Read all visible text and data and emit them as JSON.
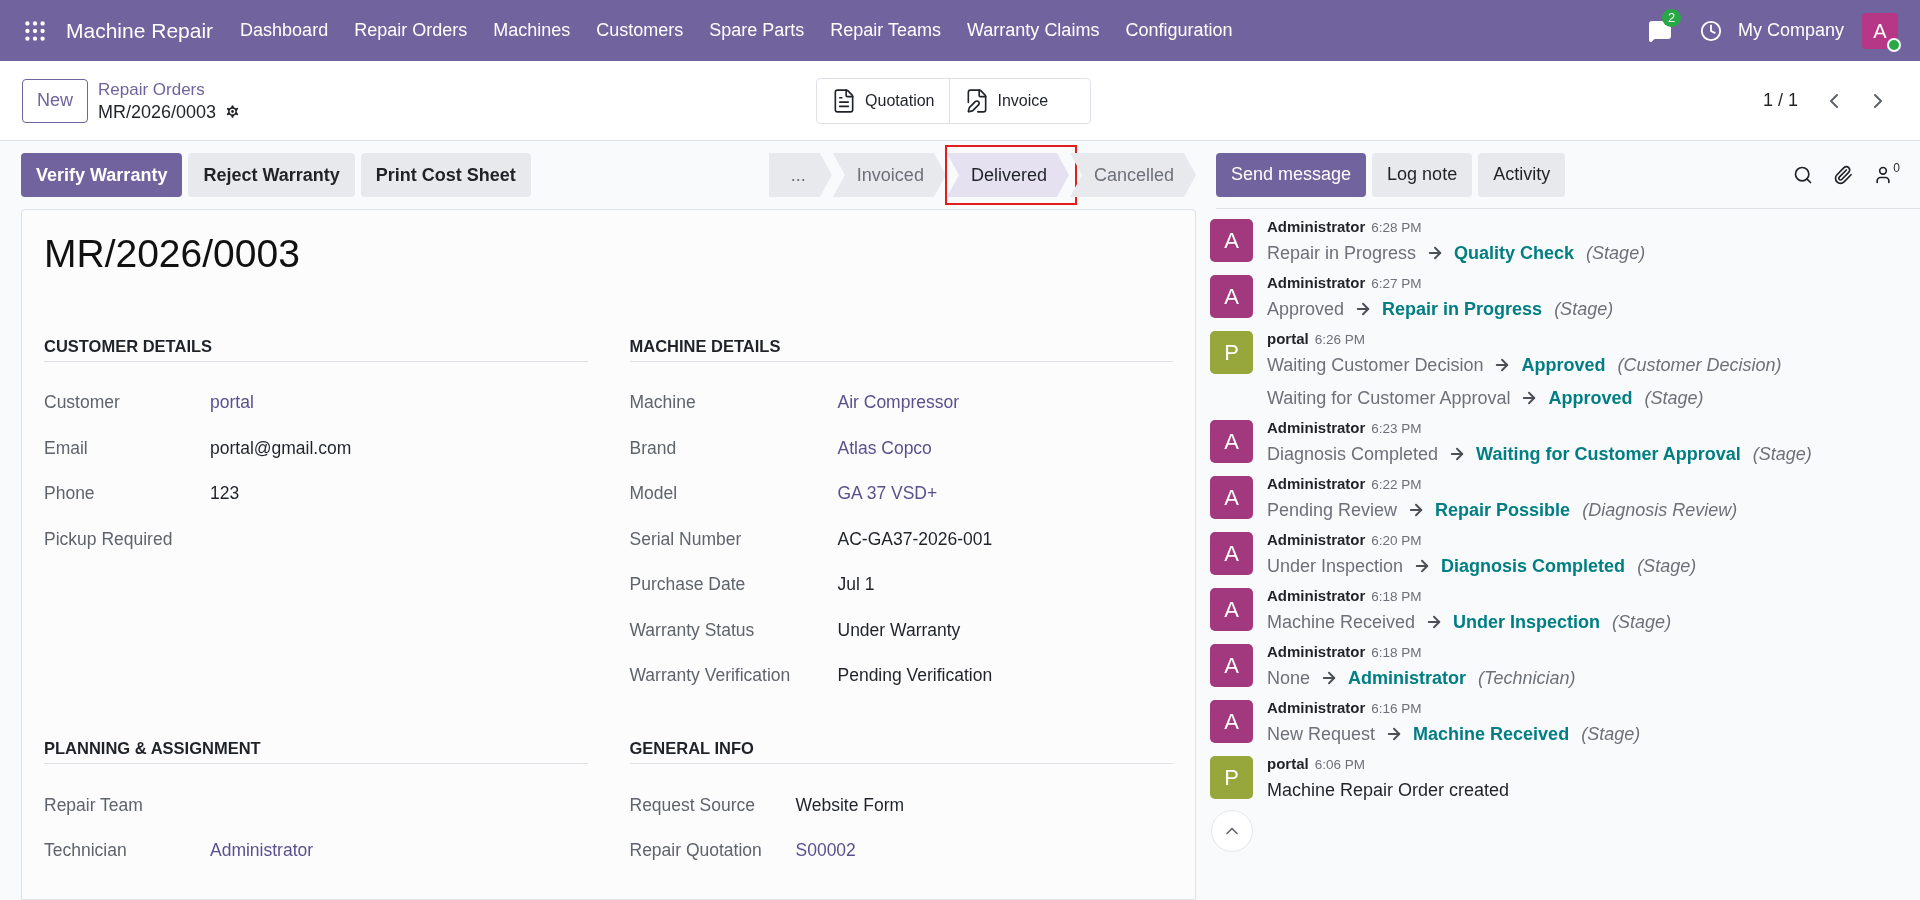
{
  "navbar": {
    "app_name": "Machine Repair",
    "menu": [
      "Dashboard",
      "Repair Orders",
      "Machines",
      "Customers",
      "Spare Parts",
      "Repair Teams",
      "Warranty Claims",
      "Configuration"
    ],
    "messages_badge": "2",
    "company": "My Company",
    "avatar_letter": "A"
  },
  "control_panel": {
    "new_button": "New",
    "breadcrumb": "Repair Orders",
    "record": "MR/2026/0003",
    "smart_buttons": [
      {
        "kind": "quotation",
        "label": "Quotation"
      },
      {
        "kind": "invoice",
        "label": "Invoice"
      }
    ],
    "pager": "1 / 1"
  },
  "actions": [
    {
      "label": "Verify Warranty",
      "primary": true
    },
    {
      "label": "Reject Warranty",
      "primary": false
    },
    {
      "label": "Print Cost Sheet",
      "primary": false
    }
  ],
  "stages": [
    {
      "label": "...",
      "selected": false,
      "highlighted": false
    },
    {
      "label": "Invoiced",
      "selected": false,
      "highlighted": false
    },
    {
      "label": "Delivered",
      "selected": true,
      "highlighted": true
    },
    {
      "label": "Cancelled",
      "selected": false,
      "highlighted": false
    }
  ],
  "form": {
    "title": "MR/2026/0003",
    "groups": [
      {
        "title": "CUSTOMER DETAILS",
        "fields": [
          {
            "label": "Customer",
            "value": "portal",
            "link": true
          },
          {
            "label": "Email",
            "value": "portal@gmail.com",
            "link": false
          },
          {
            "label": "Phone",
            "value": "123",
            "link": false
          },
          {
            "label": "Pickup Required"
          }
        ]
      },
      {
        "title": "MACHINE DETAILS",
        "fields": [
          {
            "label": "Machine",
            "value": "Air Compressor",
            "link": true
          },
          {
            "label": "Brand",
            "value": "Atlas Copco",
            "link": true
          },
          {
            "label": "Model",
            "value": "GA 37 VSD+",
            "link": true
          },
          {
            "label": "Serial Number",
            "value": "AC-GA37-2026-001",
            "link": false
          },
          {
            "label": "Purchase Date",
            "value": "Jul 1",
            "link": false
          },
          {
            "label": "Warranty Status",
            "value": "Under Warranty",
            "link": false
          },
          {
            "label": "Warranty Verification",
            "value": "Pending Verification",
            "link": false
          }
        ]
      },
      {
        "title": "PLANNING & ASSIGNMENT",
        "fields": [
          {
            "label": "Repair Team"
          },
          {
            "label": "Technician",
            "value": "Administrator",
            "link": true
          }
        ]
      },
      {
        "title": "GENERAL INFO",
        "fields": [
          {
            "label": "Request Source",
            "value": "Website Form",
            "link": false
          },
          {
            "label": "Repair Quotation",
            "value": "S00002",
            "link": true
          }
        ]
      }
    ]
  },
  "chatter": {
    "buttons": [
      {
        "label": "Send message",
        "primary": true
      },
      {
        "label": "Log note",
        "primary": false
      },
      {
        "label": "Activity",
        "primary": false
      }
    ],
    "followers": "0",
    "messages": [
      {
        "avatar": "A",
        "color": "#a2397f",
        "author": "Administrator",
        "time": "6:28 PM",
        "changes": [
          {
            "old": "Repair in Progress",
            "new": "Quality Check",
            "field": "(Stage)"
          }
        ]
      },
      {
        "avatar": "A",
        "color": "#a2397f",
        "author": "Administrator",
        "time": "6:27 PM",
        "changes": [
          {
            "old": "Approved",
            "new": "Repair in Progress",
            "field": "(Stage)"
          }
        ]
      },
      {
        "avatar": "P",
        "color": "#97a73b",
        "author": "portal",
        "time": "6:26 PM",
        "changes": [
          {
            "old": "Waiting Customer Decision",
            "new": "Approved",
            "field": "(Customer Decision)"
          },
          {
            "old": "Waiting for Customer Approval",
            "new": "Approved",
            "field": "(Stage)"
          }
        ]
      },
      {
        "avatar": "A",
        "color": "#a2397f",
        "author": "Administrator",
        "time": "6:23 PM",
        "changes": [
          {
            "old": "Diagnosis Completed",
            "new": "Waiting for Customer Approval",
            "field": "(Stage)"
          }
        ]
      },
      {
        "avatar": "A",
        "color": "#a2397f",
        "author": "Administrator",
        "time": "6:22 PM",
        "changes": [
          {
            "old": "Pending Review",
            "new": "Repair Possible",
            "field": "(Diagnosis Review)"
          }
        ]
      },
      {
        "avatar": "A",
        "color": "#a2397f",
        "author": "Administrator",
        "time": "6:20 PM",
        "changes": [
          {
            "old": "Under Inspection",
            "new": "Diagnosis Completed",
            "field": "(Stage)"
          }
        ]
      },
      {
        "avatar": "A",
        "color": "#a2397f",
        "author": "Administrator",
        "time": "6:18 PM",
        "changes": [
          {
            "old": "Machine Received",
            "new": "Under Inspection",
            "field": "(Stage)"
          }
        ]
      },
      {
        "avatar": "A",
        "color": "#a2397f",
        "author": "Administrator",
        "time": "6:18 PM",
        "changes": [
          {
            "old": "None",
            "new": "Administrator",
            "field": "(Technician)"
          }
        ]
      },
      {
        "avatar": "A",
        "color": "#a2397f",
        "author": "Administrator",
        "time": "6:16 PM",
        "changes": [
          {
            "old": "New Request",
            "new": "Machine Received",
            "field": "(Stage)"
          }
        ]
      },
      {
        "avatar": "P",
        "color": "#97a73b",
        "author": "portal",
        "time": "6:06 PM",
        "body": "Machine Repair Order created"
      }
    ]
  }
}
